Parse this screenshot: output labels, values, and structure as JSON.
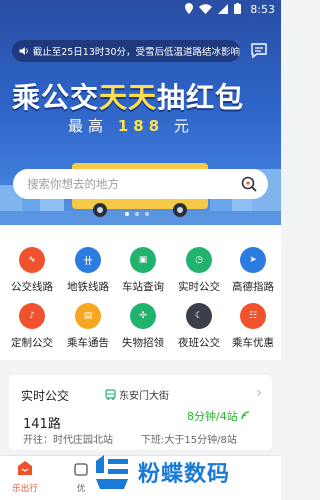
{
  "status_bar": {
    "time": "8:53"
  },
  "notice": {
    "text": "截止至25日13时30分，受雪后低温道路结冰影响"
  },
  "banner": {
    "title_part1": "乘公交",
    "title_highlight": "天天",
    "title_part3": "抽红包",
    "sub_prefix": "最高",
    "sub_amount": "188",
    "sub_unit": "元"
  },
  "search": {
    "placeholder": "搜索你想去的地方"
  },
  "grid": {
    "items": [
      {
        "label": "公交线路",
        "icon": "bus-route-icon",
        "color": "#f0522d"
      },
      {
        "label": "地铁线路",
        "icon": "subway-icon",
        "color": "#2b7be0"
      },
      {
        "label": "车站查询",
        "icon": "station-icon",
        "color": "#21b36e"
      },
      {
        "label": "实时公交",
        "icon": "realtime-icon",
        "color": "#21b36e"
      },
      {
        "label": "高德指路",
        "icon": "navigation-icon",
        "color": "#2b7be0"
      },
      {
        "label": "定制公交",
        "icon": "custom-bus-icon",
        "color": "#f0522d"
      },
      {
        "label": "乘车通告",
        "icon": "notice-icon",
        "color": "#f5a623"
      },
      {
        "label": "失物招领",
        "icon": "puzzle-icon",
        "color": "#21b36e"
      },
      {
        "label": "夜班公交",
        "icon": "night-icon",
        "color": "#3a3f49"
      },
      {
        "label": "乘车优惠",
        "icon": "discount-icon",
        "color": "#f0522d"
      }
    ]
  },
  "realtime": {
    "title": "实时公交",
    "station": "东安门大街",
    "route": "141路",
    "arrival": "8分钟/4站",
    "direction": "开往：时代庄园北站",
    "next": "下班:大于15分钟/8站"
  },
  "tabbar": {
    "tab1": "乐出行",
    "tab2": "优"
  },
  "watermark": {
    "text": "粉蝶数码"
  },
  "colors": {
    "accent": "#f0522d",
    "green": "#2cb52c"
  }
}
